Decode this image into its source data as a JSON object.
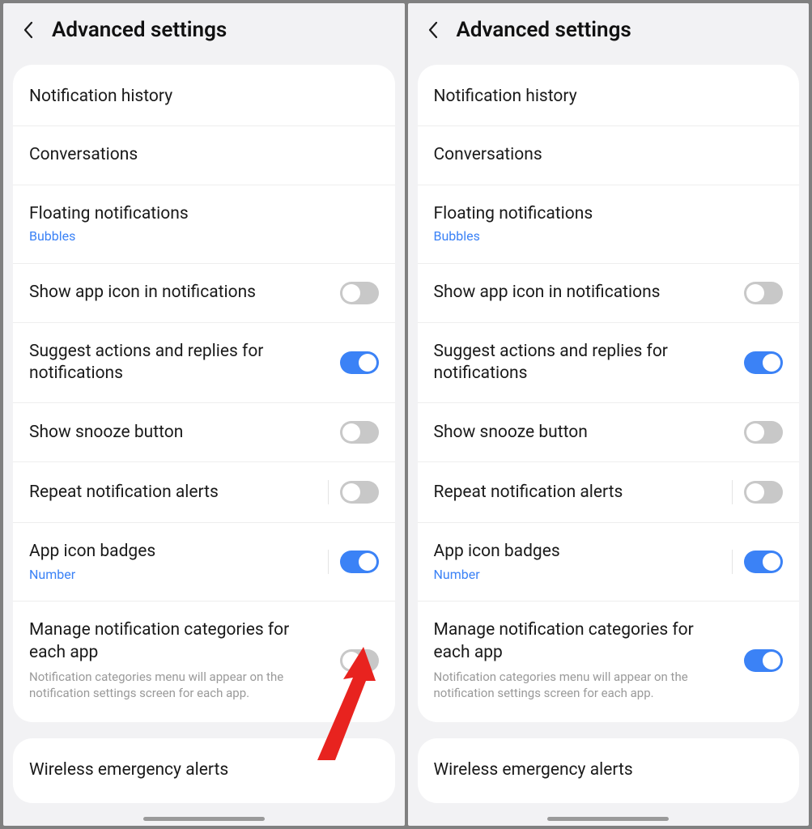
{
  "panes": [
    {
      "title": "Advanced settings",
      "showArrow": true,
      "group1": [
        {
          "label": "Notification history",
          "dn": "row-notification-history"
        },
        {
          "label": "Conversations",
          "dn": "row-conversations"
        },
        {
          "label": "Floating notifications",
          "sub": "Bubbles",
          "dn": "row-floating-notifications"
        },
        {
          "label": "Show app icon in notifications",
          "toggle": "off",
          "dn": "row-show-app-icon"
        },
        {
          "label": "Suggest actions and replies for notifications",
          "toggle": "on",
          "dn": "row-suggest-actions"
        },
        {
          "label": "Show snooze button",
          "toggle": "off",
          "dn": "row-show-snooze"
        },
        {
          "label": "Repeat notification alerts",
          "toggle": "off",
          "sep": true,
          "dn": "row-repeat-alerts"
        },
        {
          "label": "App icon badges",
          "sub": "Number",
          "toggle": "on",
          "sep": true,
          "dn": "row-app-icon-badges"
        },
        {
          "label": "Manage notification categories for each app",
          "desc": "Notification categories menu will appear on the notification settings screen for each app.",
          "toggle": "off",
          "dn": "row-manage-categories"
        }
      ],
      "group2": [
        {
          "label": "Wireless emergency alerts",
          "dn": "row-wireless-emergency"
        }
      ]
    },
    {
      "title": "Advanced settings",
      "showArrow": false,
      "group1": [
        {
          "label": "Notification history",
          "dn": "row-notification-history"
        },
        {
          "label": "Conversations",
          "dn": "row-conversations"
        },
        {
          "label": "Floating notifications",
          "sub": "Bubbles",
          "dn": "row-floating-notifications"
        },
        {
          "label": "Show app icon in notifications",
          "toggle": "off",
          "dn": "row-show-app-icon"
        },
        {
          "label": "Suggest actions and replies for notifications",
          "toggle": "on",
          "dn": "row-suggest-actions"
        },
        {
          "label": "Show snooze button",
          "toggle": "off",
          "dn": "row-show-snooze"
        },
        {
          "label": "Repeat notification alerts",
          "toggle": "off",
          "sep": true,
          "dn": "row-repeat-alerts"
        },
        {
          "label": "App icon badges",
          "sub": "Number",
          "toggle": "on",
          "sep": true,
          "dn": "row-app-icon-badges"
        },
        {
          "label": "Manage notification categories for each app",
          "desc": "Notification categories menu will appear on the notification settings screen for each app.",
          "toggle": "on",
          "dn": "row-manage-categories"
        }
      ],
      "group2": [
        {
          "label": "Wireless emergency alerts",
          "dn": "row-wireless-emergency"
        }
      ]
    }
  ]
}
